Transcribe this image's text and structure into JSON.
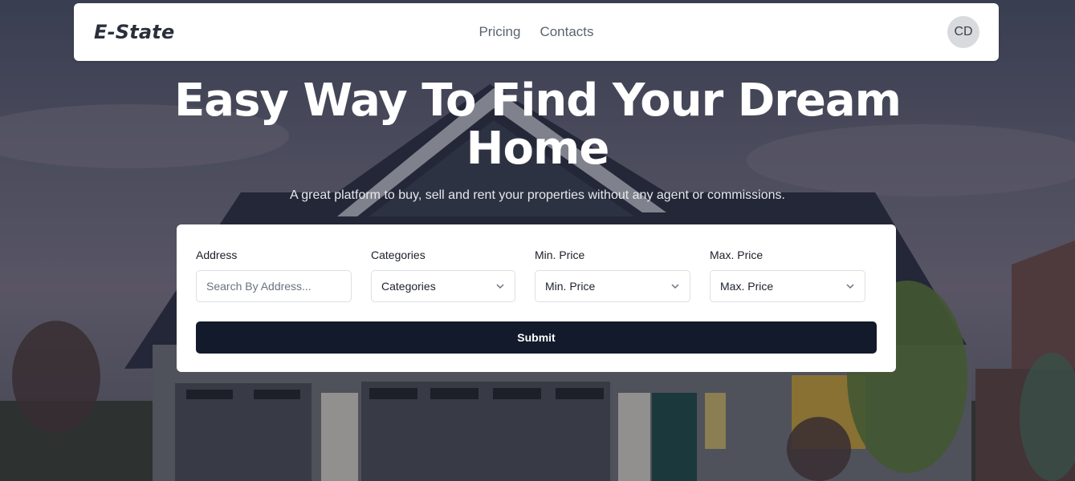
{
  "brand": {
    "logo": "E-State"
  },
  "nav": {
    "links": [
      "Pricing",
      "Contacts"
    ]
  },
  "user": {
    "initials": "CD"
  },
  "hero": {
    "title_line1": "Easy Way To Find Your Dream",
    "title_line2": "Home",
    "subtitle": "A great platform to buy, sell and rent your properties without any agent or commissions."
  },
  "search": {
    "address": {
      "label": "Address",
      "placeholder": "Search By Address..."
    },
    "categories": {
      "label": "Categories",
      "selected": "Categories",
      "icon": "chevron-down-icon"
    },
    "min_price": {
      "label": "Min. Price",
      "selected": "Min. Price",
      "icon": "chevron-down-icon"
    },
    "max_price": {
      "label": "Max. Price",
      "selected": "Max. Price",
      "icon": "chevron-down-icon"
    },
    "submit_label": "Submit"
  },
  "colors": {
    "navbar_bg": "#ffffff",
    "submit_bg": "#121a2b",
    "avatar_bg": "#d9dadd",
    "hero_text": "#ffffff"
  }
}
